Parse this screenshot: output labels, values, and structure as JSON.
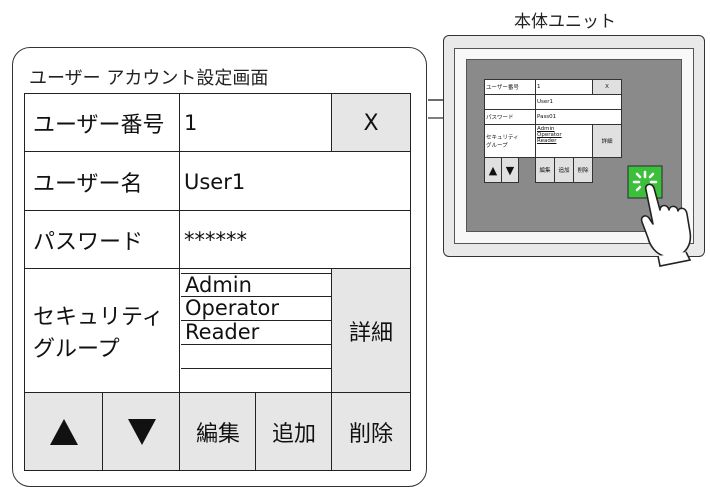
{
  "device": {
    "title": "本体ユニット"
  },
  "screen": {
    "title": "ユーザー アカウント設定画面",
    "rows": {
      "user_number": {
        "label": "ユーザー番号",
        "value": "1",
        "clear_button": "X"
      },
      "user_name": {
        "label": "ユーザー名",
        "value": "User1"
      },
      "password": {
        "label": "パスワード",
        "value": "******"
      },
      "security_group": {
        "label_line1": "セキュリティ",
        "label_line2": "グループ",
        "options": [
          "Admin",
          "Operator",
          "Reader"
        ],
        "detail_button": "詳細"
      }
    },
    "buttons": {
      "up": "▲",
      "down": "▼",
      "edit": "編集",
      "add": "追加",
      "delete": "削除"
    }
  },
  "mini_screen": {
    "user_number_label": "ユーザー番号",
    "user_number_value": "1",
    "clear_button": "X",
    "user_name_value": "User1",
    "password_label": "パスワード",
    "password_value": "Pass01",
    "security_label_line1": "セキュリティ",
    "security_label_line2": "グループ",
    "options": [
      "Admin",
      "Operator",
      "Reader"
    ],
    "detail_button": "詳細",
    "edit": "編集",
    "add": "追加",
    "delete": "削除"
  },
  "colors": {
    "button_gray": "#e6e6e6",
    "screen_gray": "#8a8a8a",
    "touch_green": "#3cc03c"
  }
}
